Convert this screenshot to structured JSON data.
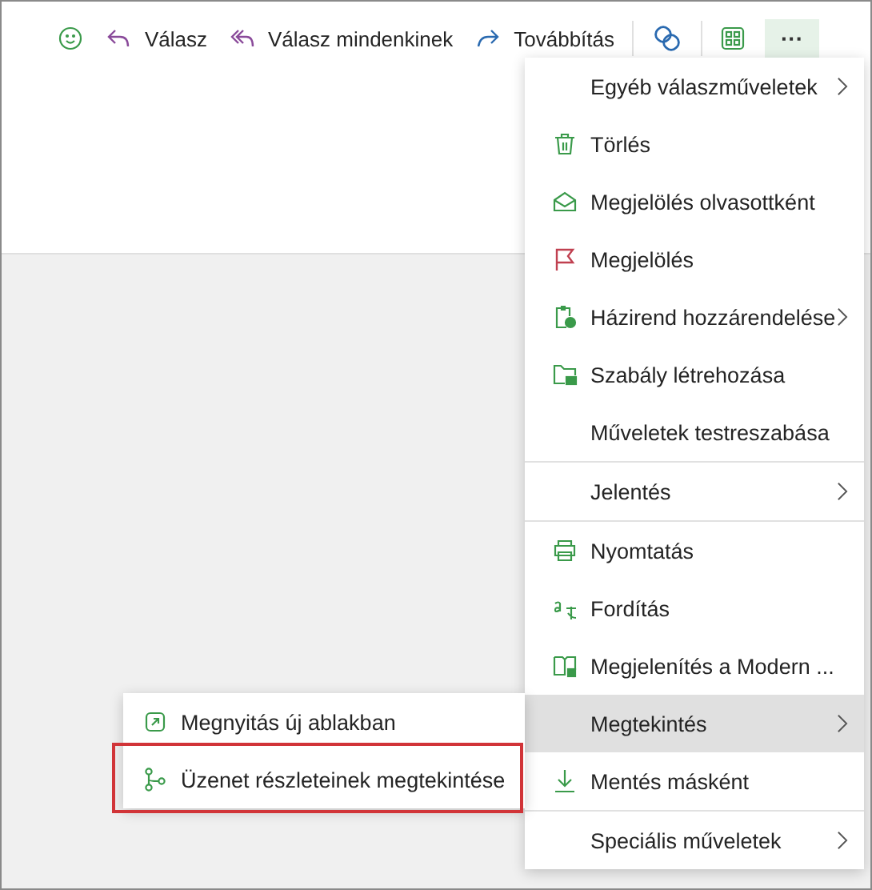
{
  "toolbar": {
    "items": [
      {
        "kind": "emoji"
      },
      {
        "kind": "reply",
        "label": "Válasz"
      },
      {
        "kind": "reply_all",
        "label": "Válasz mindenkinek"
      },
      {
        "kind": "forward",
        "label": "Továbbítás"
      },
      {
        "kind": "loop"
      },
      {
        "kind": "apps"
      }
    ],
    "more_button": {
      "label": "···",
      "selected": true
    }
  },
  "menu": {
    "items": [
      {
        "kind": "none",
        "label": "Egyéb válaszműveletek",
        "submenu": true,
        "selected": false,
        "divider_after": false
      },
      {
        "kind": "delete",
        "label": "Törlés",
        "submenu": false,
        "selected": false,
        "divider_after": false
      },
      {
        "kind": "read",
        "label": "Megjelölés olvasottként",
        "submenu": false,
        "selected": false,
        "divider_after": false
      },
      {
        "kind": "flag",
        "label": "Megjelölés",
        "submenu": false,
        "selected": false,
        "divider_after": false
      },
      {
        "kind": "policy",
        "label": "Házirend hozzárendelése",
        "submenu": true,
        "selected": false,
        "divider_after": false
      },
      {
        "kind": "rule",
        "label": "Szabály létrehozása",
        "submenu": false,
        "selected": false,
        "divider_after": false
      },
      {
        "kind": "none",
        "label": "Műveletek testreszabása",
        "submenu": false,
        "selected": false,
        "divider_after": true
      },
      {
        "kind": "none",
        "label": "Jelentés",
        "submenu": true,
        "selected": false,
        "divider_after": true
      },
      {
        "kind": "print",
        "label": "Nyomtatás",
        "submenu": false,
        "selected": false,
        "divider_after": false
      },
      {
        "kind": "translate",
        "label": "Fordítás",
        "submenu": false,
        "selected": false,
        "divider_after": false
      },
      {
        "kind": "reader",
        "label": "Megjelenítés a Modern ...",
        "submenu": false,
        "selected": false,
        "divider_after": false
      },
      {
        "kind": "none",
        "label": "Megtekintés",
        "submenu": true,
        "selected": true,
        "divider_after": false
      },
      {
        "kind": "save",
        "label": "Mentés másként",
        "submenu": false,
        "selected": false,
        "divider_after": true
      },
      {
        "kind": "none",
        "label": "Speciális műveletek",
        "submenu": true,
        "selected": false,
        "divider_after": false
      }
    ]
  },
  "submenu": {
    "items": [
      {
        "kind": "open_window",
        "label": "Megnyitás új ablakban",
        "highlighted": false
      },
      {
        "kind": "details",
        "label": "Üzenet részleteinek megtekintése",
        "highlighted": true
      }
    ]
  }
}
